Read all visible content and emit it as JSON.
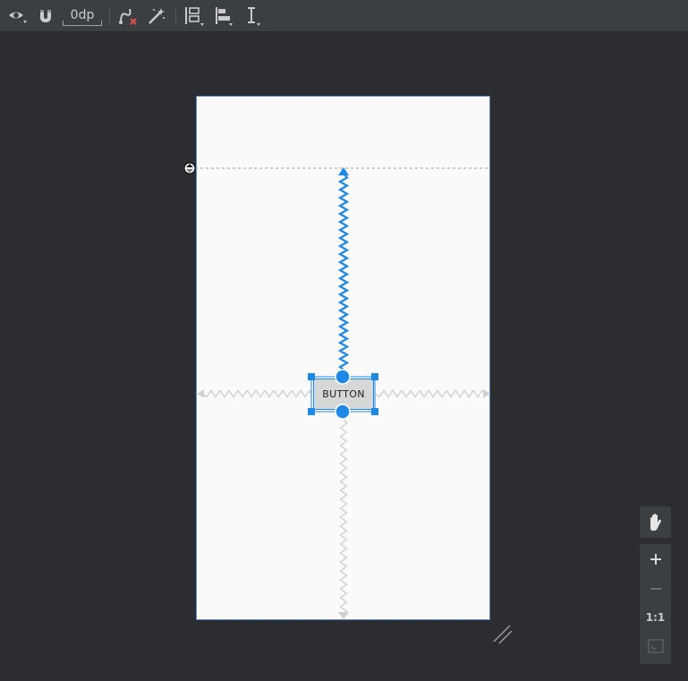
{
  "toolbar": {
    "default_margin": "0dp",
    "icons": [
      "eye-icon",
      "magnet-icon",
      "clear-constraints-icon",
      "infer-constraints-icon",
      "pack-icon",
      "align-icon",
      "guidelines-icon"
    ]
  },
  "canvas": {
    "widget_label": "BUTTON",
    "accent_color": "#1e88e5",
    "surface_color": "#fafafa",
    "background_color": "#2b2d30"
  },
  "zoom_panel": {
    "actual_size_label": "1:1",
    "icons": [
      "pan-hand-icon",
      "zoom-in-icon",
      "zoom-out-icon",
      "zoom-to-fit-icon"
    ]
  }
}
